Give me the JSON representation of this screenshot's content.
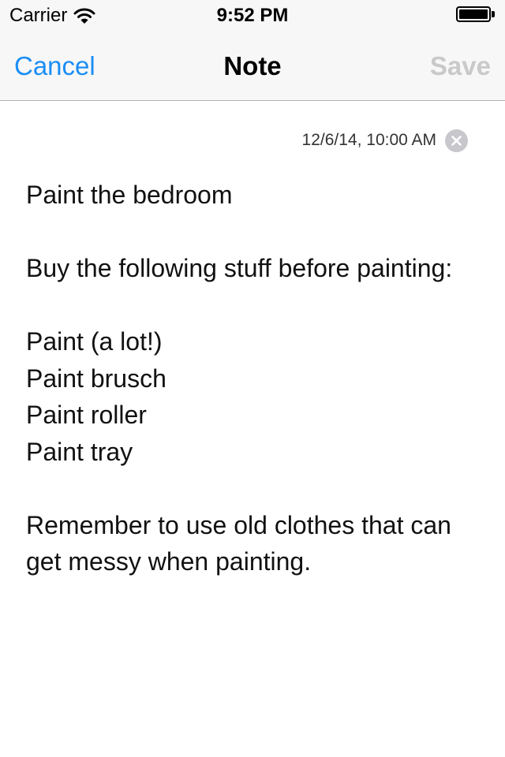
{
  "status_bar": {
    "carrier": "Carrier",
    "time": "9:52 PM",
    "wifi_icon": "wifi-icon",
    "battery_icon": "battery-icon",
    "battery_level_percent": 100
  },
  "nav": {
    "cancel_label": "Cancel",
    "title": "Note",
    "save_label": "Save",
    "save_enabled": false
  },
  "reminder": {
    "date": "12/6/14, 10:00 AM",
    "clear_icon": "clear-x-icon"
  },
  "note": {
    "text": "Paint the bedroom\n\nBuy the following stuff before painting:\n\nPaint (a lot!)\nPaint brusch\nPaint roller\nPaint tray\n\nRemember to use old clothes that can get messy when painting."
  },
  "colors": {
    "accent": "#1b8ef5",
    "disabled": "#c9c9c9",
    "nav_background": "#f7f7f7",
    "clear_button": "#c7c7cc"
  }
}
